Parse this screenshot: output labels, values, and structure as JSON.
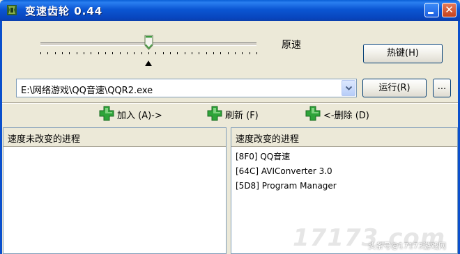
{
  "window": {
    "title": "变速齿轮 0.44",
    "app_icon": "gear-app-icon",
    "controls": [
      "minimize-icon",
      "close-icon"
    ],
    "close_glyph": "✕"
  },
  "speed": {
    "label": "原速",
    "level": 0.5
  },
  "toolbar": {
    "hotkey_label": "热键(H)",
    "run_label": "运行(R)",
    "browse_label": "..."
  },
  "path_combo": {
    "value": "E:\\网络游戏\\QQ音速\\QQR2.exe"
  },
  "actions": {
    "add_label": "加入 (A)->",
    "refresh_label": "刷新 (F)",
    "remove_label": "<-删除 (D)"
  },
  "lists": {
    "unchanged_header": "速度未改变的进程",
    "changed_header": "速度改变的进程",
    "unchanged_items": [],
    "changed_items": [
      "[8F0] QQ音速",
      "[64C] AVIConverter 3.0",
      "[5D8] Program Manager"
    ]
  },
  "watermark": {
    "logo": "17173.com",
    "note": "头条号@17173游戏网"
  },
  "colors": {
    "titlebar": "#0b56d3",
    "window_bg": "#ece9d8",
    "plus_icon": "#2ea43a"
  }
}
